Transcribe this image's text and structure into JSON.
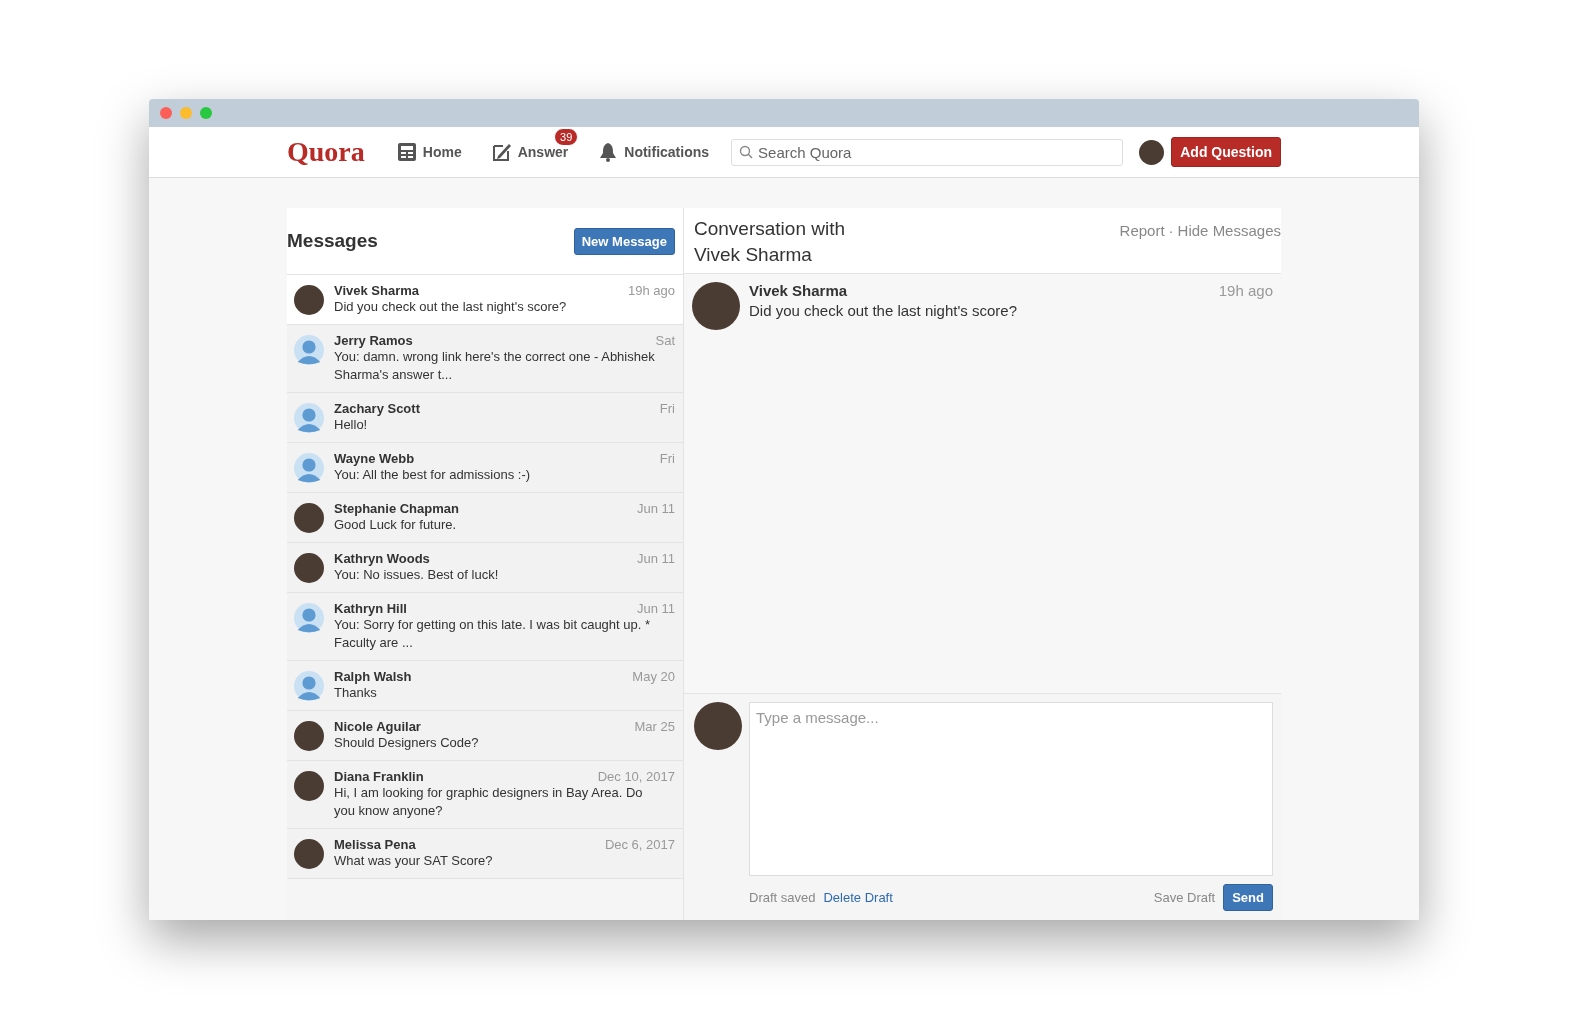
{
  "window": {
    "controls": [
      {
        "color": "#fc5f57"
      },
      {
        "color": "#fdbc2e"
      },
      {
        "color": "#28c840"
      }
    ]
  },
  "nav": {
    "logo": "Quora",
    "items": [
      {
        "label": "Home",
        "kind": "home"
      },
      {
        "label": "Answer",
        "kind": "answer",
        "badge": "39"
      },
      {
        "label": "Notifications",
        "kind": "notifications"
      }
    ],
    "search": {
      "placeholder": "Search Quora"
    },
    "add_button": "Add Question"
  },
  "messages": {
    "title": "Messages",
    "new_button": "New Message",
    "threads": [
      {
        "name": "Vivek Sharma",
        "time": "19h ago",
        "preview": "Did you check out the last night's score?",
        "kind": "photo",
        "selected": true
      },
      {
        "name": "Jerry Ramos",
        "time": "Sat",
        "preview": "You: damn. wrong link here's the correct one - Abhishek Sharma's answer t...",
        "kind": "default",
        "selected": false
      },
      {
        "name": "Zachary Scott",
        "time": "Fri",
        "preview": "Hello!",
        "kind": "default",
        "selected": false
      },
      {
        "name": "Wayne Webb",
        "time": "Fri",
        "preview": "You: All the best for admissions :-)",
        "kind": "default",
        "selected": false
      },
      {
        "name": "Stephanie Chapman",
        "time": "Jun 11",
        "preview": "Good Luck for future.",
        "kind": "photo",
        "selected": false
      },
      {
        "name": "Kathryn Woods",
        "time": "Jun 11",
        "preview": "You: No issues. Best of luck!",
        "kind": "photo",
        "selected": false
      },
      {
        "name": "Kathryn Hill",
        "time": "Jun 11",
        "preview": "You: Sorry for getting on this late. I was bit caught up. * Faculty are ...",
        "kind": "default",
        "selected": false
      },
      {
        "name": "Ralph Walsh",
        "time": "May 20",
        "preview": "Thanks",
        "kind": "default",
        "selected": false
      },
      {
        "name": "Nicole Aguilar",
        "time": "Mar 25",
        "preview": "Should Designers Code?",
        "kind": "photo",
        "selected": false
      },
      {
        "name": "Diana Franklin",
        "time": "Dec 10, 2017",
        "preview": "Hi, I am looking for graphic designers in Bay Area. Do you know anyone?",
        "kind": "photo",
        "selected": false
      },
      {
        "name": "Melissa Pena",
        "time": "Dec 6, 2017",
        "preview": "What was your SAT Score?",
        "kind": "photo",
        "selected": false
      }
    ]
  },
  "conversation": {
    "title": "Conversation with Vivek Sharma",
    "actions": [
      "Report",
      "Hide Messages"
    ],
    "separator": "·",
    "messages": [
      {
        "name": "Vivek Sharma",
        "time": "19h ago",
        "text": "Did you check out the last night's score?"
      }
    ],
    "composer": {
      "placeholder": "Type a message...",
      "status": "Draft saved",
      "delete_link": "Delete Draft",
      "save_link": "Save Draft",
      "send_button": "Send"
    }
  }
}
